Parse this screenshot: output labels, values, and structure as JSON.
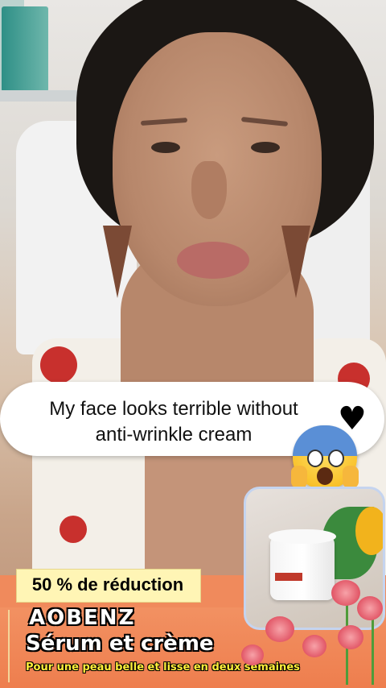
{
  "caption": {
    "line1": "My face looks terrible without",
    "line2": "anti-wrinkle cream",
    "emoji_heart": "♥",
    "emoji_face": "face-screaming-in-fear"
  },
  "promo": {
    "discount": "50 % de réduction",
    "brand": "AOBENZ",
    "product": "Sérum et crème",
    "tagline": "Pour une peau belle et lisse en deux semaines"
  },
  "colors": {
    "banner": "#f08a5c",
    "tag": "#fff5b5",
    "tagline": "#ffef3a",
    "card_border": "#c5d4ef"
  }
}
